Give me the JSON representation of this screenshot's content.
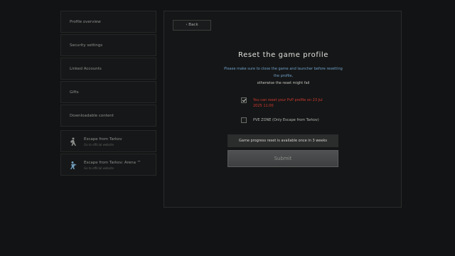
{
  "sidebar": {
    "items": [
      {
        "label": "Profile overview"
      },
      {
        "label": "Security settings"
      },
      {
        "label": "Linked Accounts"
      },
      {
        "label": "Gifts"
      },
      {
        "label": "Downloadable content"
      }
    ],
    "games": [
      {
        "title": "Escape from Tarkov",
        "subtitle": "Go to official website",
        "icon": "tarkov-game-icon"
      },
      {
        "title": "Escape from Tarkov: Arena ™",
        "subtitle": "Go to official website",
        "icon": "arena-game-icon"
      }
    ]
  },
  "panel": {
    "back_label": "‹  Back",
    "title": "Reset the game profile",
    "info_line1": "Please make sure to close the game and launcher before resetting",
    "info_line2": "the profile,",
    "info_line3": "otherwise the reset might fail",
    "options": [
      {
        "label_line1": "You can reset your PvP profile on 23 Jul",
        "label_line2": "2025 11:00",
        "checked": true
      },
      {
        "label_line1": "PVE ZONE (Only Escape from Tarkov)",
        "label_line2": "",
        "checked": false
      }
    ],
    "notice": "Game progress reset is available once in 3 weeks",
    "submit_label": "Submit"
  },
  "colors": {
    "background": "#121314",
    "accent_blue": "#6ea0c8",
    "warning_red": "#cf3a30"
  }
}
